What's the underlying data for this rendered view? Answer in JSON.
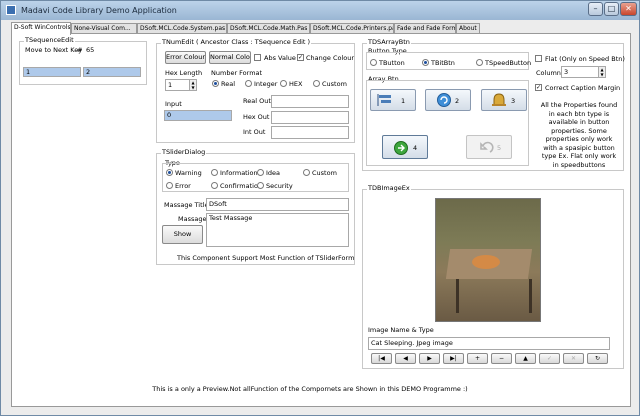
{
  "window": {
    "title": "Madavi Code Library Demo Application"
  },
  "caption_buttons": {
    "minimize": "–",
    "maximize": "□",
    "close": "✕"
  },
  "tabs": [
    {
      "label": "D-Soft WinControls"
    },
    {
      "label": "None-Visual Com..."
    },
    {
      "label": "DSoft.MCL.Code.System.pas"
    },
    {
      "label": "DSoft.MCL.Code.Math.Pas"
    },
    {
      "label": "DSoft.MCL.Code.Printers.pas"
    },
    {
      "label": "Fade and Fade Form"
    },
    {
      "label": "About"
    }
  ],
  "tsequence": {
    "group": "TSequenceEdit",
    "move_label": "Move to Next Key",
    "hash": "#",
    "value_a": "65",
    "field1": "1",
    "field2": "2"
  },
  "tnumedit": {
    "group": "TNumEdit ( Ancestor Class : TSequence Edit )",
    "error_colour": "Error Colour",
    "normal_colour": "Normal Colour",
    "abs_value": "Abs Value",
    "change_colour": "Change Colour",
    "change_check": "✓",
    "hex_length_label": "Hex Length",
    "hex_length": "1",
    "spin_up": "▲",
    "spin_down": "▼",
    "number_format_label": "Number Format",
    "formats": [
      "Real",
      "Integer",
      "HEX",
      "Custom"
    ],
    "input_label": "Input",
    "input_value": "0",
    "real_out": "Real Out",
    "hex_out": "Hex Out",
    "int_out": "Int Out"
  },
  "tslider": {
    "group": "TSliderDialog",
    "type_label": "Type",
    "types": [
      "Warning",
      "Information",
      "Idea",
      "Custom",
      "Error",
      "Confirmation",
      "Security"
    ],
    "title_label": "Massage Title",
    "title_value": "DSoft",
    "massage_label": "Massage",
    "massage_value": "Test Massage",
    "show_button": "Show",
    "note": "This Component Support  Most Function of TSliderForm"
  },
  "tdsarray": {
    "group": "TDSArrayBtn",
    "button_type_label": "Button Type",
    "button_types": [
      "TButton",
      "TBitBtn",
      "TSpeedButton"
    ],
    "array_label": "Array Btn",
    "btn_numbers": [
      "1",
      "2",
      "3",
      "4",
      "5"
    ],
    "flat_label": "Flat (Only on Speed Btn)",
    "columns_label": "Columns",
    "columns_value": "3",
    "correct_caption": "Correct Caption Margin",
    "correct_check": "✓",
    "description": "All the Properties  found in each btn type is available in button properties. Some properties only work with a spasipic button type Ex. Flat only work in speedbuttons"
  },
  "tdbimage": {
    "group": "TDBImageEx",
    "name_label": "Image Name & Type",
    "name_value": "Cat Sleeping. Jpeg image",
    "nav_glyphs": [
      "|◀",
      "◀",
      "▶",
      "▶|",
      "+",
      "−",
      "▲",
      "✓",
      "✕",
      "↻"
    ]
  },
  "footer": "This is a only a Preview.Not allFunction of the Compornets are Shown in this DEMO Programme :)"
}
